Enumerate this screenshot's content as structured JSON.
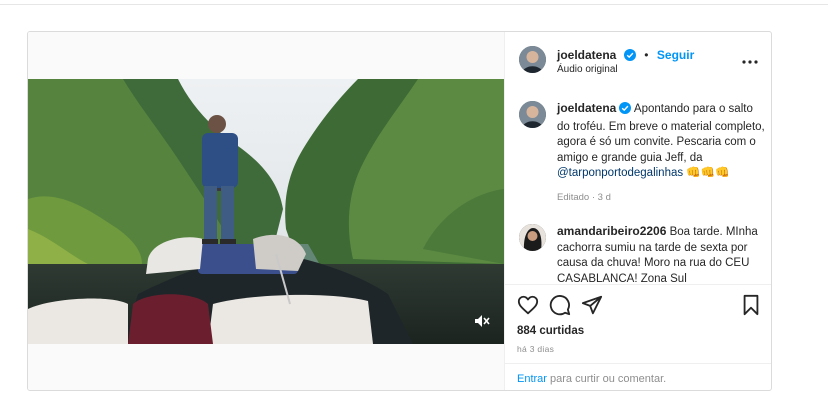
{
  "post": {
    "author": "joeldatena",
    "follow_label": "Seguir",
    "dot": "•",
    "audio_label": "Áudio original",
    "more_label": "•••",
    "caption_text": "Apontando para o salto do troféu. Em breve o material completo, agora é só um convite. Pescaria com o amigo e grande guia Jeff, da ",
    "caption_mention": "@tarponportodegalinhas",
    "caption_emoji": " 👊👊👊",
    "caption_meta": "Editado · 3 d",
    "comment": {
      "user": "amandaribeiro2206",
      "text": "Boa tarde. MInha cachorra sumiu na tarde de sexta por causa da chuva! Moro na rua do CEU CASABLANCA! Zona Sul"
    },
    "likes": "884 curtidas",
    "date": "há 3 dias",
    "login_link": "Entrar",
    "login_text": " para curtir ou comentar."
  },
  "icons": {
    "like": "heart-icon",
    "comment": "comment-icon",
    "share": "share-icon",
    "save": "bookmark-icon",
    "mute": "speaker-muted-icon",
    "verified": "verified-badge-icon"
  },
  "colors": {
    "accent": "#0095f6",
    "muted_text": "#8e8e8e",
    "verified": "#0095f6"
  }
}
